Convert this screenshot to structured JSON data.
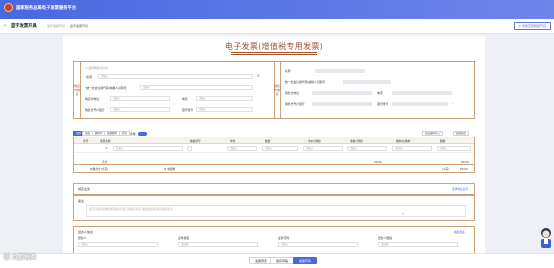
{
  "app": {
    "title": "国家税务总局电子发票服务平台"
  },
  "subheader": {
    "back_icon": "arrow-left-icon",
    "title": "蓝字发票开具",
    "breadcrumbs": [
      "蓝字发票开具",
      "蓝字发票开具"
    ],
    "history_button": "切换至原税控开具"
  },
  "invoice": {
    "title": "电子发票(增值税专用发票)",
    "buyer": {
      "tag": "购买方信息",
      "check_label": "选择购买方信息",
      "name_label": "名称",
      "name_placeholder": "请输入",
      "taxid_label": "统一社会信用代码/纳税人识别号",
      "taxid_placeholder": "请输入",
      "address_label": "购买方地址",
      "address_placeholder": "请输入",
      "phone_label": "电话",
      "phone_placeholder": "请输入",
      "bank_label": "购买方开户银行",
      "bank_placeholder": "请输入",
      "account_label": "银行账号",
      "account_placeholder": "请输入"
    },
    "seller": {
      "tag": "销售方信息",
      "name_label": "名称",
      "taxid_label": "统一社会信用代码/纳税人识别号",
      "address_label": "销售方地址",
      "phone_label": "电话",
      "bank_label": "销售方开户银行",
      "account_label": "银行账号"
    },
    "toolbar": {
      "buttons": [
        "项目",
        "添加",
        "删除行",
        "批量删除",
        "折扣",
        "含税"
      ],
      "right_buttons": [
        "商品编码导入",
        "选择商品"
      ]
    },
    "items": {
      "headers": [
        "序号",
        "项目名称",
        "规格型号",
        "单位",
        "数量",
        "单价(含税)",
        "金额(含税)",
        "税率/征收率",
        "税额"
      ],
      "rows": [
        {
          "no": "1",
          "name": "请输入",
          "spec": "",
          "unit": "请输入",
          "qty": "请输入",
          "price": "请输入",
          "amount": "请输入",
          "rate": "请选择",
          "tax": "请输入"
        }
      ],
      "total_label": "合计",
      "total_amount": "¥0.00",
      "total_tax": "¥0.00",
      "grand_label": "价税合计(大写)",
      "grand_words": "零圆整",
      "grand_small_label": "(小写)",
      "grand_small": "¥0.00"
    },
    "special": {
      "title": "特定业务",
      "link": "选择特定业务"
    },
    "remark": {
      "title": "备注",
      "placeholder": "如开具发票需要在票面备注栏处打印相关信息,请在此处填写相关备注信息"
    },
    "operator": {
      "title": "经办人信息",
      "link": "收起更多",
      "fields": [
        {
          "label": "经办人",
          "placeholder": "请输入"
        },
        {
          "label": "证件类型",
          "placeholder": "请选择"
        },
        {
          "label": "证件号码",
          "placeholder": "请输入"
        },
        {
          "label": "经办人国籍",
          "placeholder": "请选择"
        }
      ]
    }
  },
  "actions": {
    "preview": "发票预览",
    "save_draft": "保存草稿",
    "issue": "发票开具"
  },
  "watermark": "Ⓒ 九郡税务",
  "colors": {
    "primary": "#4a68e0",
    "border": "#c9a27d",
    "title": "#a0522d"
  }
}
